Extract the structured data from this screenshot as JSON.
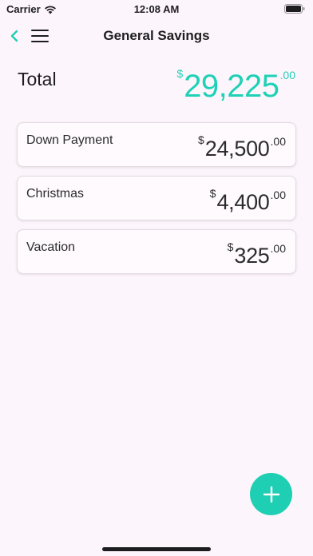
{
  "status_bar": {
    "carrier": "Carrier",
    "time": "12:08 AM",
    "wifi_icon": "wifi-icon",
    "battery_icon": "battery-icon"
  },
  "nav": {
    "title": "General Savings",
    "back_icon": "chevron-left-icon",
    "menu_icon": "hamburger-menu-icon"
  },
  "total": {
    "label": "Total",
    "currency_symbol": "$",
    "whole": "29,225",
    "cents": ".00"
  },
  "accounts": [
    {
      "label": "Down Payment",
      "currency_symbol": "$",
      "whole": "24,500",
      "cents": ".00"
    },
    {
      "label": "Christmas",
      "currency_symbol": "$",
      "whole": "4,400",
      "cents": ".00"
    },
    {
      "label": "Vacation",
      "currency_symbol": "$",
      "whole": "325",
      "cents": ".00"
    }
  ],
  "fab": {
    "icon": "plus-icon"
  },
  "colors": {
    "accent": "#1fcfb3",
    "background": "#fdf5fc"
  }
}
